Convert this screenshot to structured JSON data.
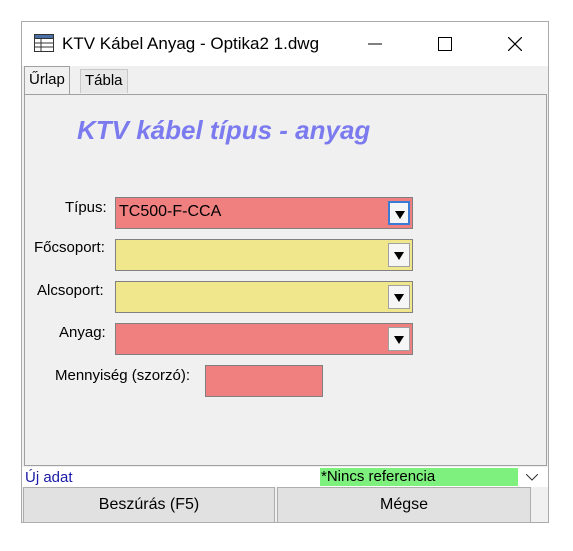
{
  "window": {
    "title": "KTV Kábel Anyag - Optika2 1.dwg"
  },
  "tabs": [
    {
      "label": "Űrlap",
      "active": true
    },
    {
      "label": "Tábla",
      "active": false
    }
  ],
  "form": {
    "title": "KTV kábel típus - anyag",
    "fields": {
      "tipus": {
        "label": "Típus:",
        "value": "TC500-F-CCA",
        "color": "#f08080"
      },
      "focsoport": {
        "label": "Főcsoport:",
        "value": "",
        "color": "#f0e68c"
      },
      "alcsoport": {
        "label": "Alcsoport:",
        "value": "",
        "color": "#f0e68c"
      },
      "anyag": {
        "label": "Anyag:",
        "value": "",
        "color": "#f08080"
      },
      "mennyiseg": {
        "label": "Mennyiség (szorzó):",
        "value": "",
        "color": "#f08080"
      }
    }
  },
  "status": {
    "left": "Új adat",
    "reference": "*Nincs referencia",
    "reference_color": "#7df07d"
  },
  "buttons": {
    "insert": "Beszúrás (F5)",
    "cancel": "Mégse"
  },
  "colors": {
    "title_accent": "#7b7bef",
    "status_text": "#1a1aa6"
  }
}
